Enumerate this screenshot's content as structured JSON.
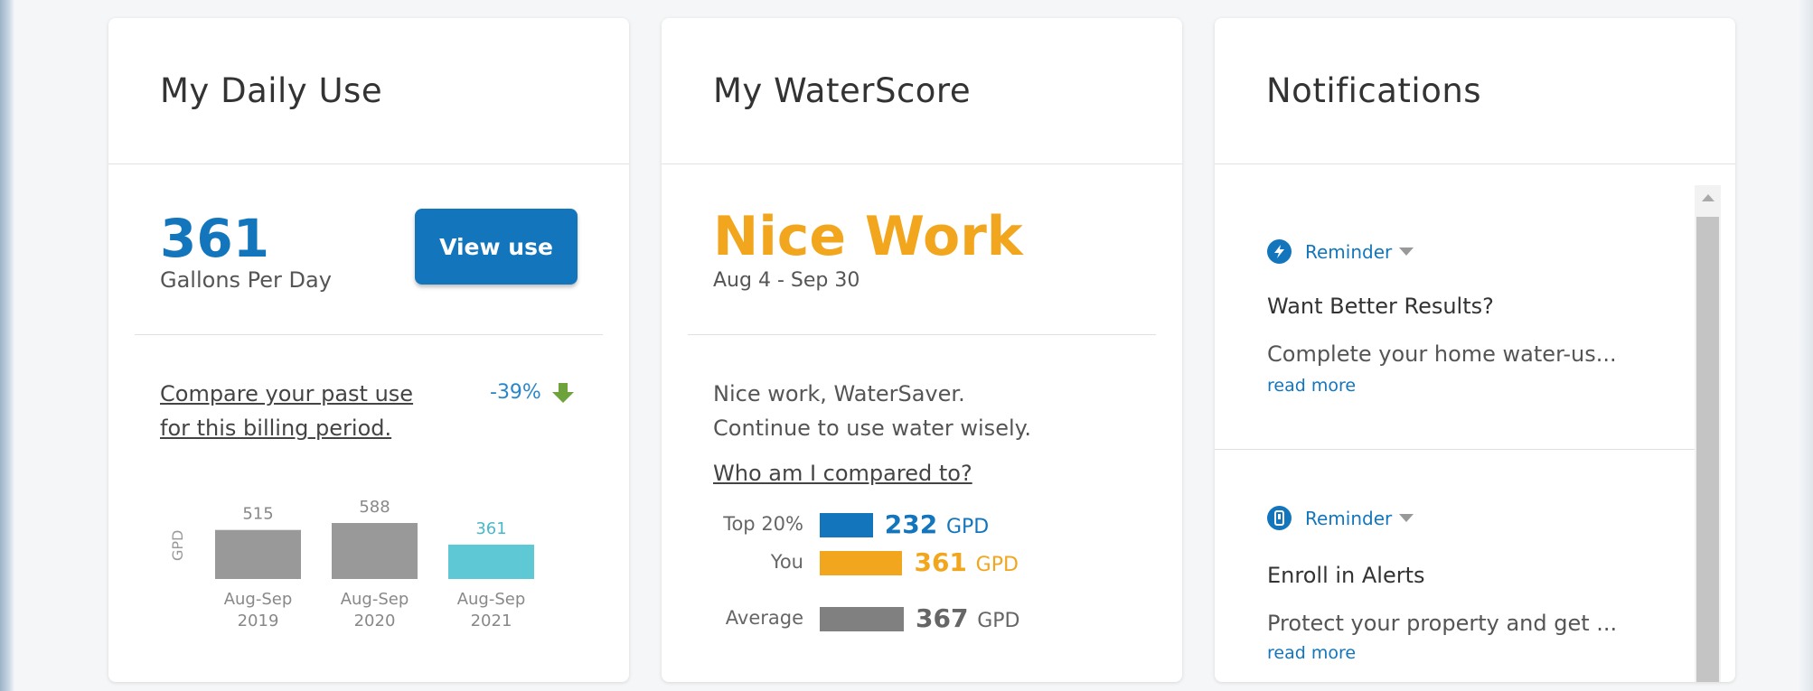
{
  "daily_use": {
    "title": "My Daily Use",
    "value": "361",
    "unit_label": "Gallons Per Day",
    "view_button": "View use",
    "compare_text": "Compare your past use for this billing period.",
    "change_pct": "-39%",
    "axis_label": "GPD",
    "chart_data": {
      "type": "bar",
      "categories": [
        "Aug-Sep 2019",
        "Aug-Sep 2020",
        "Aug-Sep 2021"
      ],
      "category_lines": [
        [
          "Aug-Sep",
          "2019"
        ],
        [
          "Aug-Sep",
          "2020"
        ],
        [
          "Aug-Sep",
          "2021"
        ]
      ],
      "values": [
        515,
        588,
        361
      ],
      "value_labels": [
        "515",
        "588",
        "361"
      ],
      "colors": [
        "#999999",
        "#999999",
        "#5ec8d4"
      ],
      "label_colors": [
        "#888888",
        "#888888",
        "#4ab8c8"
      ],
      "ylabel": "GPD"
    }
  },
  "water_score": {
    "title": "My WaterScore",
    "rating": "Nice Work",
    "date_range": "Aug 4 - Sep 30",
    "message_line1": "Nice work, WaterSaver.",
    "message_line2": "Continue to use water wisely.",
    "compare_link": "Who am I compared to?",
    "comparison": [
      {
        "label": "Top 20%",
        "value": "232",
        "unit": "GPD",
        "raw": 232,
        "color": "#1376bd"
      },
      {
        "label": "You",
        "value": "361",
        "unit": "GPD",
        "raw": 361,
        "color": "#f2a61d"
      },
      {
        "label": "Average",
        "value": "367",
        "unit": "GPD",
        "raw": 367,
        "color": "#808080"
      }
    ]
  },
  "notifications": {
    "title": "Notifications",
    "items": [
      {
        "tag": "Reminder",
        "title": "Want Better Results?",
        "body": "Complete your home water-us...",
        "link": "read more",
        "icon": "bolt-icon"
      },
      {
        "tag": "Reminder",
        "title": "Enroll in Alerts",
        "body": "Protect your property and get ...",
        "link": "read more",
        "icon": "phone-icon"
      }
    ]
  },
  "colors": {
    "primary": "#1376bd",
    "accent": "#f2a61d",
    "green_arrow": "#6ea23a"
  }
}
